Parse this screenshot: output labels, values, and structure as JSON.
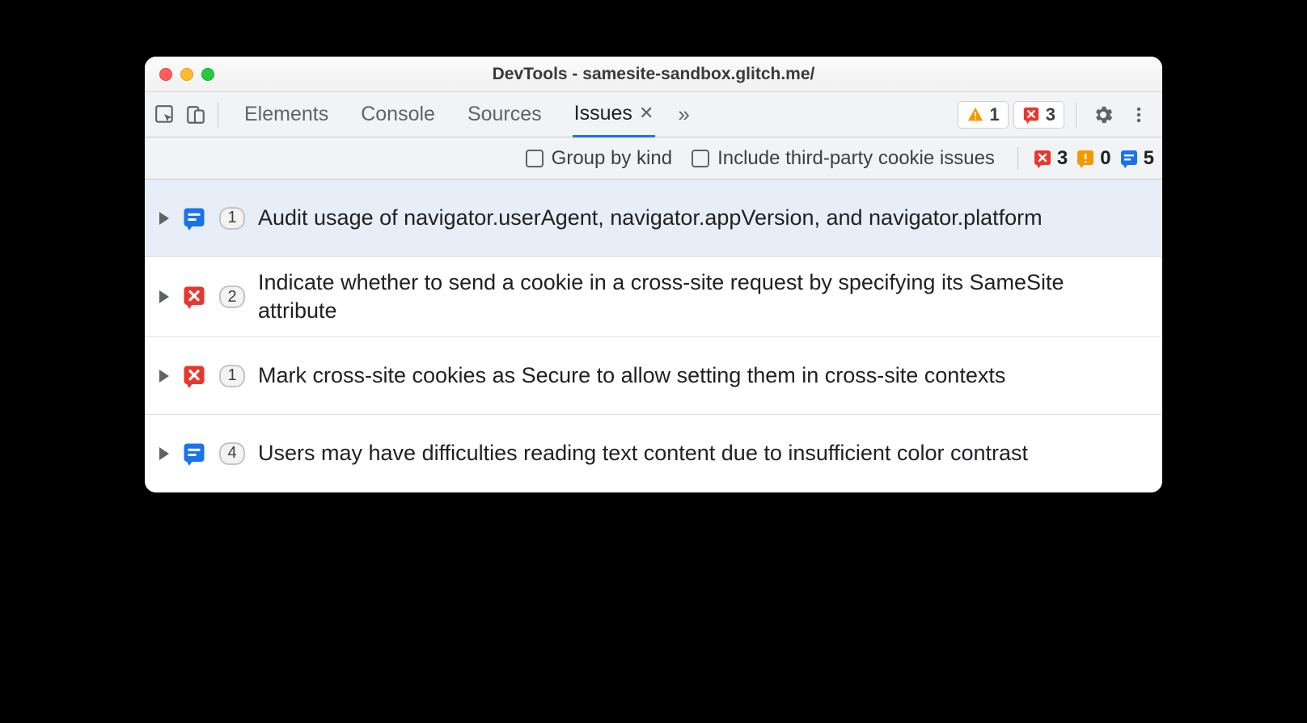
{
  "window": {
    "title": "DevTools - samesite-sandbox.glitch.me/"
  },
  "tabs": {
    "elements": "Elements",
    "console": "Console",
    "sources": "Sources",
    "issues": "Issues"
  },
  "toolbar_badges": {
    "warnings": "1",
    "errors": "3"
  },
  "subtoolbar": {
    "group_by_kind": "Group by kind",
    "include_third_party": "Include third-party cookie issues",
    "error_count": "3",
    "alert_count": "0",
    "info_count": "5"
  },
  "issues": [
    {
      "kind": "info",
      "count": "1",
      "title": "Audit usage of navigator.userAgent, navigator.appVersion, and navigator.platform",
      "selected": true
    },
    {
      "kind": "error",
      "count": "2",
      "title": "Indicate whether to send a cookie in a cross-site request by specifying its SameSite attribute",
      "selected": false
    },
    {
      "kind": "error",
      "count": "1",
      "title": "Mark cross-site cookies as Secure to allow setting them in cross-site contexts",
      "selected": false
    },
    {
      "kind": "info",
      "count": "4",
      "title": "Users may have difficulties reading text content due to insufficient color contrast",
      "selected": false
    }
  ]
}
